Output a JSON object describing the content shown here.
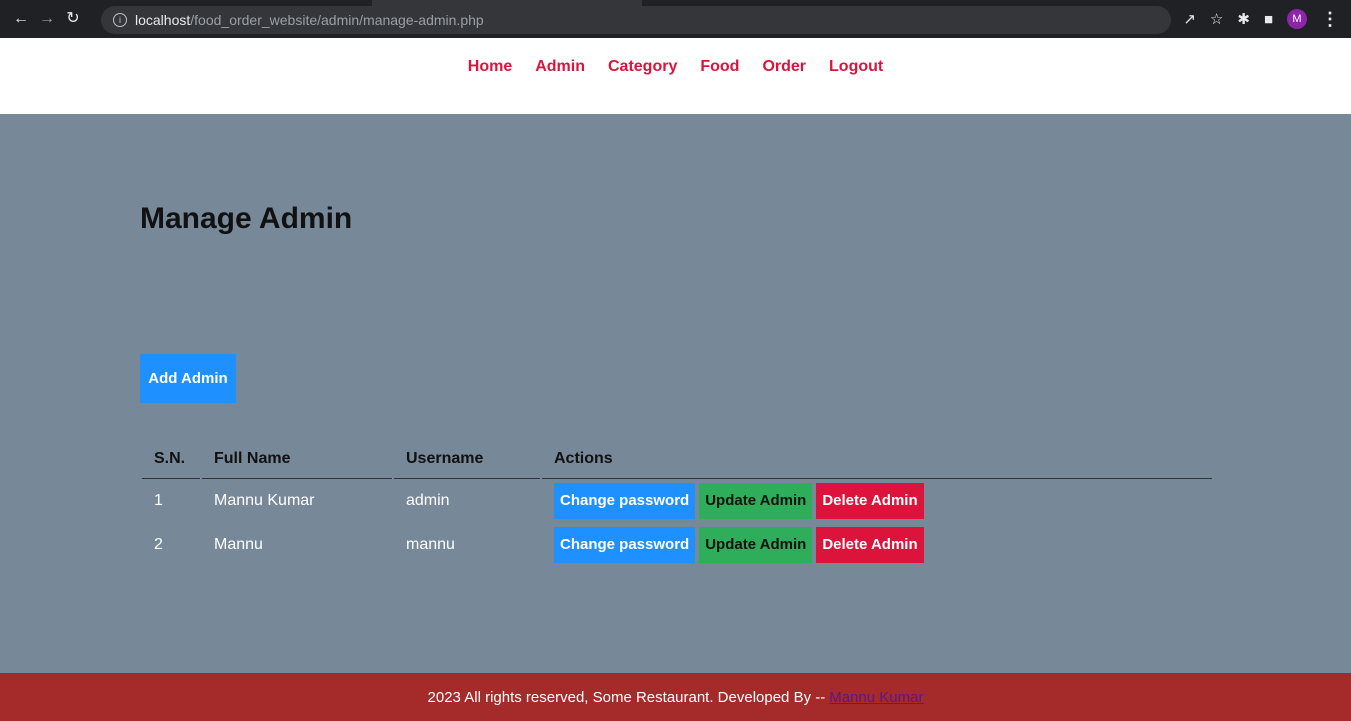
{
  "browser": {
    "url_host": "localhost",
    "url_path": "/food_order_website/admin/manage-admin.php",
    "avatar_letter": "M",
    "icons": [
      "back-arrow-icon",
      "forward-arrow-icon",
      "reload-icon",
      "info-icon",
      "share-icon",
      "star-icon",
      "extensions-icon",
      "sidepanel-icon",
      "kebab-menu-icon"
    ]
  },
  "nav": {
    "items": [
      {
        "label": "Home"
      },
      {
        "label": "Admin"
      },
      {
        "label": "Category"
      },
      {
        "label": "Food"
      },
      {
        "label": "Order"
      },
      {
        "label": "Logout"
      }
    ]
  },
  "main": {
    "title": "Manage Admin",
    "add_button": "Add Admin",
    "table": {
      "headers": [
        "S.N.",
        "Full Name",
        "Username",
        "Actions"
      ],
      "rows": [
        {
          "sn": "1",
          "full_name": "Mannu Kumar",
          "username": "admin"
        },
        {
          "sn": "2",
          "full_name": "Mannu",
          "username": "mannu"
        }
      ],
      "actions": {
        "change_password": "Change password",
        "update": "Update Admin",
        "delete": "Delete Admin"
      }
    }
  },
  "footer": {
    "text": "2023 All rights reserved, Some Restaurant. Developed By --",
    "link": "Mannu Kumar"
  },
  "colors": {
    "nav_link": "#dc143c",
    "main_bg": "#778899",
    "footer_bg": "#a52a2a",
    "primary_btn": "#1e90ff",
    "success_btn": "#2ead5a",
    "danger_btn": "#dc143c"
  }
}
